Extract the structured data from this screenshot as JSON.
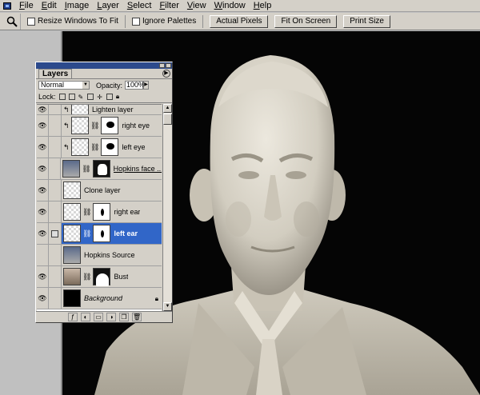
{
  "menu": [
    {
      "label": "File",
      "u": "F",
      "rest": "ile"
    },
    {
      "label": "Edit",
      "u": "E",
      "rest": "dit"
    },
    {
      "label": "Image",
      "u": "I",
      "rest": "mage"
    },
    {
      "label": "Layer",
      "u": "L",
      "rest": "ayer"
    },
    {
      "label": "Select",
      "u": "S",
      "rest": "elect"
    },
    {
      "label": "Filter",
      "u": "F",
      "rest": "ilter"
    },
    {
      "label": "View",
      "u": "V",
      "rest": "iew"
    },
    {
      "label": "Window",
      "u": "W",
      "rest": "indow"
    },
    {
      "label": "Help",
      "u": "H",
      "rest": "elp"
    }
  ],
  "options": {
    "resize_windows": "Resize Windows To Fit",
    "ignore_palettes": "Ignore Palettes",
    "actual_pixels": "Actual Pixels",
    "fit_on_screen": "Fit On Screen",
    "print_size": "Print Size"
  },
  "layers_palette": {
    "tab": "Layers",
    "blend_mode": "Normal",
    "opacity_label": "Opacity:",
    "opacity_value": "100%",
    "lock_label": "Lock:",
    "partial_layer": "Lighten layer",
    "layers": [
      {
        "name": "right eye"
      },
      {
        "name": "left eye"
      },
      {
        "name": "Hopkins face ..."
      },
      {
        "name": "Clone layer"
      },
      {
        "name": "right ear"
      },
      {
        "name": "left ear"
      },
      {
        "name": "Hopkins Source"
      },
      {
        "name": "Bust"
      },
      {
        "name": "Background"
      }
    ]
  },
  "colors": {
    "selection": "#3166c8",
    "title_bar": "#2c4a8c",
    "canvas_bg": "#050505"
  }
}
